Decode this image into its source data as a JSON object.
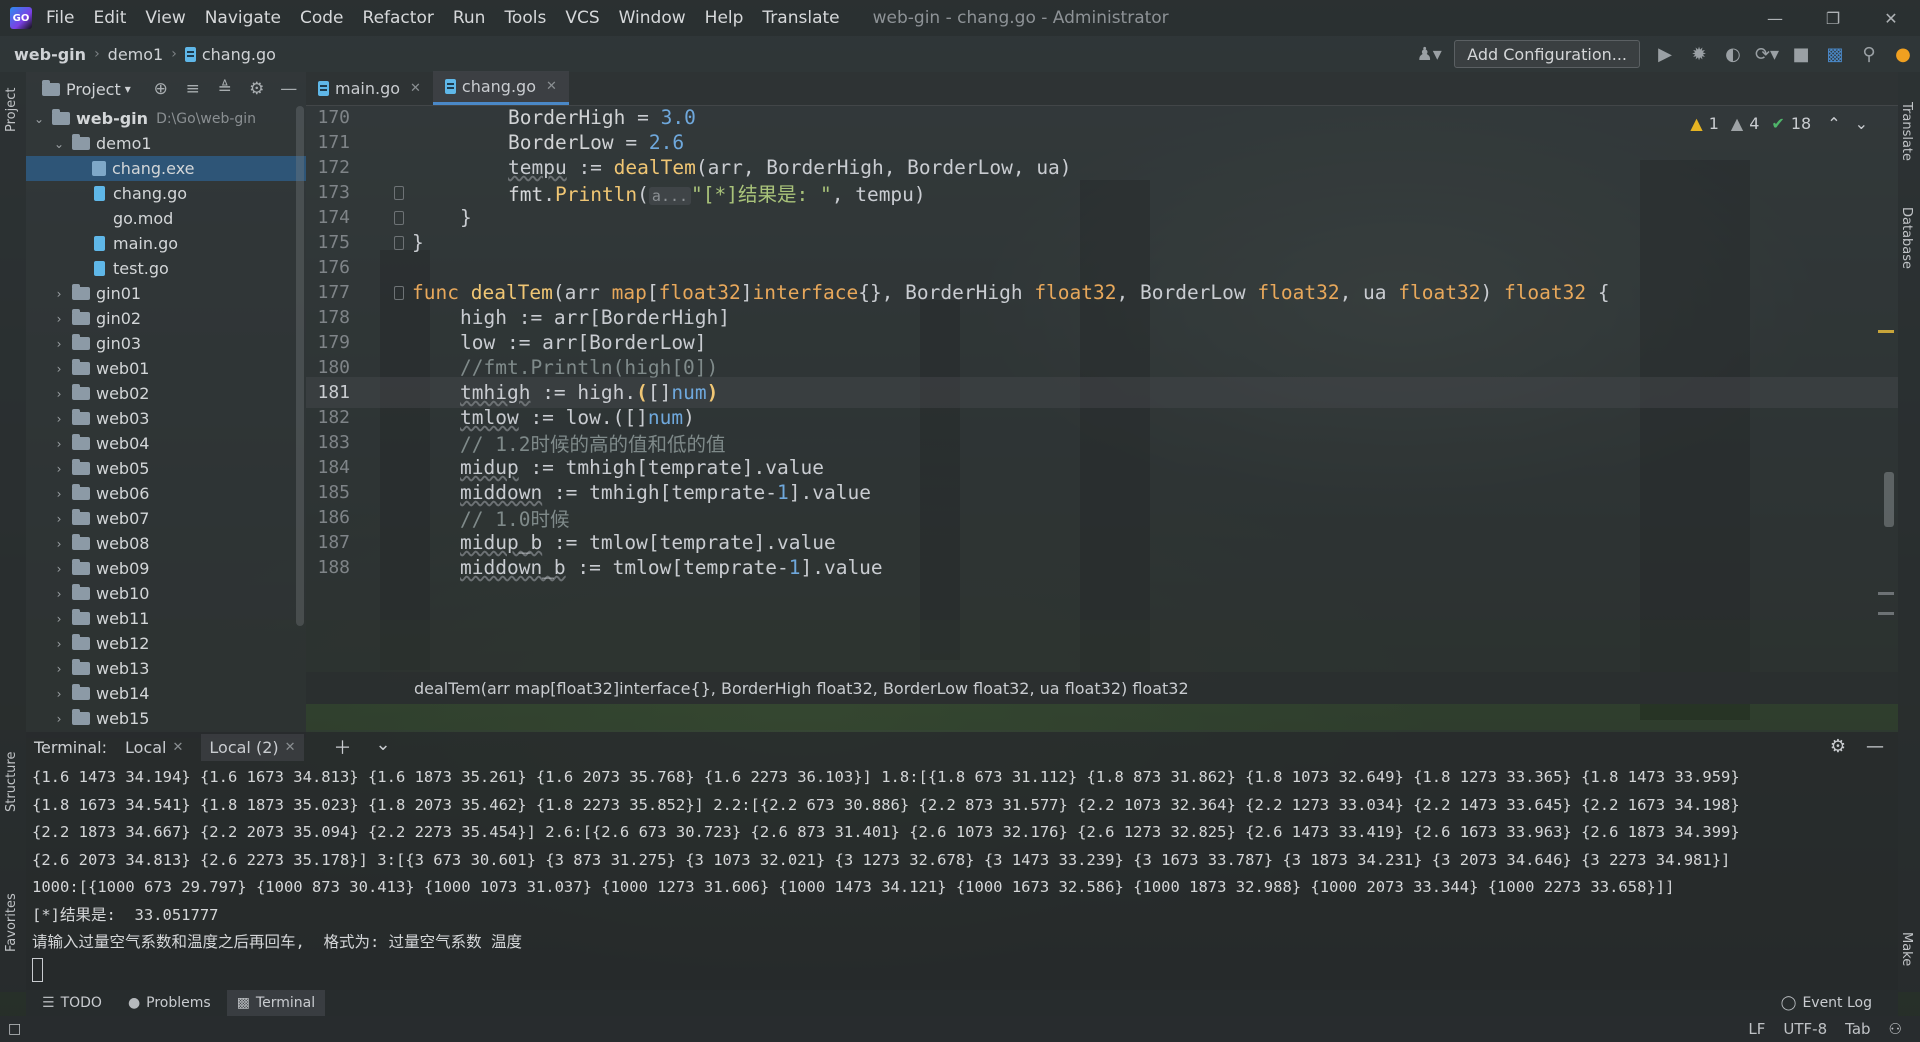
{
  "menubar": {
    "items": [
      "File",
      "Edit",
      "View",
      "Navigate",
      "Code",
      "Refactor",
      "Run",
      "Tools",
      "VCS",
      "Window",
      "Help",
      "Translate"
    ],
    "window_title": "web-gin - chang.go - Administrator"
  },
  "breadcrumb": [
    "web-gin",
    "demo1",
    "chang.go"
  ],
  "toolbar": {
    "add_config": "Add Configuration..."
  },
  "project": {
    "header": "Project",
    "root": {
      "label": "web-gin",
      "path": "D:\\Go\\web-gin"
    },
    "demo1": "demo1",
    "files": [
      "chang.exe",
      "chang.go",
      "go.mod",
      "main.go",
      "test.go"
    ],
    "folders": [
      "gin01",
      "gin02",
      "gin03",
      "web01",
      "web02",
      "web03",
      "web04",
      "web05",
      "web06",
      "web07",
      "web08",
      "web09",
      "web10",
      "web11",
      "web12",
      "web13",
      "web14",
      "web15"
    ]
  },
  "left_strip": {
    "project": "Project",
    "structure": "Structure",
    "favorites": "Favorites"
  },
  "right_strip": {
    "translate": "Translate",
    "database": "Database",
    "make": "Make"
  },
  "editor": {
    "tabs": [
      "main.go",
      "chang.go"
    ],
    "inspections": {
      "warnings": "1",
      "weak": "4",
      "ok": "18"
    },
    "line_numbers": [
      "170",
      "171",
      "172",
      "173",
      "174",
      "175",
      "176",
      "177",
      "178",
      "179",
      "180",
      "181",
      "182",
      "183",
      "184",
      "185",
      "186",
      "187",
      "188"
    ],
    "current_line": "181",
    "code": {
      "l170": [
        "BorderHigh",
        " = ",
        "3.0"
      ],
      "l171": [
        "BorderLow",
        " = ",
        "2.6"
      ],
      "l172": [
        "tempu",
        " := ",
        "dealTem",
        "(arr, BorderHigh, BorderLow, ua)"
      ],
      "l173": [
        "fmt",
        ".",
        "Println",
        "(",
        "a...",
        "\"[*]结果是: \"",
        ", tempu)"
      ],
      "l174": "}",
      "l175": "}",
      "l177": [
        "func",
        "dealTem",
        "(arr ",
        "map",
        "[",
        "float32",
        "]",
        "interface",
        "{}, BorderHigh ",
        "float32",
        ", BorderLow ",
        "float32",
        ", ua ",
        "float32",
        ") ",
        "float32",
        " {"
      ],
      "l178": "high := arr[BorderHigh]",
      "l179": "low := arr[BorderLow]",
      "l180": "//fmt.Println(high[0])",
      "l181": [
        "tmhigh",
        " := high.",
        "(",
        "[]",
        "num",
        ")"
      ],
      "l182": [
        "tmlow",
        " := low.([]",
        "num",
        ")"
      ],
      "l183": "// 1.2时候的高的值和低的值",
      "l184": [
        "midup",
        " := tmhigh[temprate].value"
      ],
      "l185": [
        "middown",
        " := tmhigh[temprate-",
        "1",
        "].value"
      ],
      "l186": "// 1.0时候",
      "l187": [
        "midup_b",
        " := tmlow[temprate].value"
      ],
      "l188": [
        "middown_b",
        " := tmlow[temprate-",
        "1",
        "].value"
      ]
    },
    "signature": "dealTem(arr map[float32]interface{}, BorderHigh float32, BorderLow float32, ua float32) float32"
  },
  "terminal": {
    "label": "Terminal:",
    "tabs": [
      "Local",
      "Local (2)"
    ],
    "lines": [
      "{1.6 1473 34.194} {1.6 1673 34.813} {1.6 1873 35.261} {1.6 2073 35.768} {1.6 2273 36.103}] 1.8:[{1.8 673 31.112} {1.8 873 31.862} {1.8 1073 32.649} {1.8 1273 33.365} {1.8 1473 33.959}",
      "{1.8 1673 34.541} {1.8 1873 35.023} {1.8 2073 35.462} {1.8 2273 35.852}] 2.2:[{2.2 673 30.886} {2.2 873 31.577} {2.2 1073 32.364} {2.2 1273 33.034} {2.2 1473 33.645} {2.2 1673 34.198}",
      "{2.2 1873 34.667} {2.2 2073 35.094} {2.2 2273 35.454}] 2.6:[{2.6 673 30.723} {2.6 873 31.401} {2.6 1073 32.176} {2.6 1273 32.825} {2.6 1473 33.419} {2.6 1673 33.963} {2.6 1873 34.399}",
      "{2.6 2073 34.813} {2.6 2273 35.178}] 3:[{3 673 30.601} {3 873 31.275} {3 1073 32.021} {3 1273 32.678} {3 1473 33.239} {3 1673 33.787} {3 1873 34.231} {3 2073 34.646} {3 2273 34.981}]",
      "1000:[{1000 673 29.797} {1000 873 30.413} {1000 1073 31.037} {1000 1273 31.606} {1000 1473 34.121} {1000 1673 32.586} {1000 1873 32.988} {1000 2073 33.344} {1000 2273 33.658}]]",
      "[*]结果是:  33.051777",
      "请输入过量空气系数和温度之后再回车,  格式为: 过量空气系数 温度"
    ]
  },
  "bottom_tabs": {
    "todo": "TODO",
    "problems": "Problems",
    "terminal": "Terminal",
    "event_log": "Event Log"
  },
  "status": {
    "line_sep": "LF",
    "encoding": "UTF-8",
    "indent": "Tab"
  }
}
